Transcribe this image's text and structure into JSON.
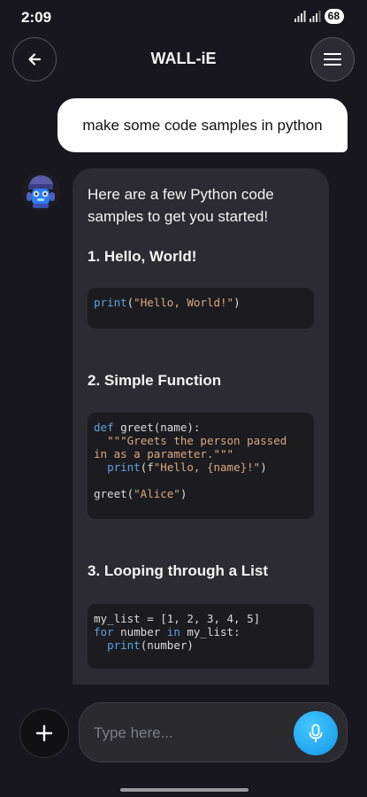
{
  "status_bar": {
    "time": "2:09",
    "battery": "68"
  },
  "header": {
    "title": "WALL-iE",
    "back_icon": "arrow-left-icon",
    "menu_icon": "hamburger-menu-icon"
  },
  "chat": {
    "user_message": "make some code samples in python",
    "assistant": {
      "avatar_icon": "robot-avatar-icon",
      "intro": "Here are a few Python code samples to get you started!",
      "sections": [
        {
          "heading": "1. Hello, World!",
          "code_lines": [
            "print(\"Hello, World!\")"
          ]
        },
        {
          "heading": "2. Simple Function",
          "code_lines": [
            "def greet(name):",
            "  \"\"\"Greets the person passed",
            "in as a parameter.\"\"\"",
            "  print(f\"Hello, {name}!\")",
            "",
            "greet(\"Alice\")"
          ]
        },
        {
          "heading": "3. Looping through a List",
          "code_lines": [
            "my_list = [1, 2, 3, 4, 5]",
            "for number in my_list:",
            "  print(number)"
          ]
        }
      ]
    }
  },
  "composer": {
    "placeholder": "Type here...",
    "add_icon": "plus-icon",
    "mic_icon": "microphone-icon"
  },
  "colors": {
    "background": "#17171d",
    "card": "#2c2b31",
    "code_bg": "#1c1c20",
    "keyword": "#5fa0e2",
    "string": "#d9a882",
    "mic_accent": "#1ea9f5"
  }
}
